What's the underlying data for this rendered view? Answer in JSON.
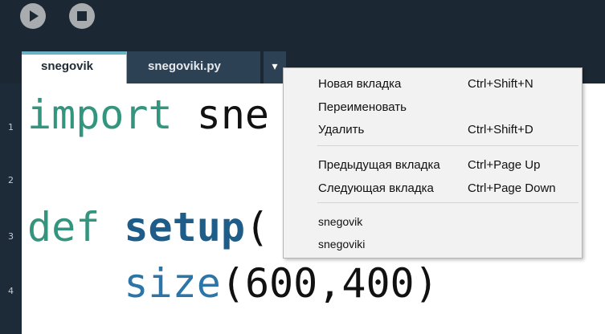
{
  "toolbar": {
    "run_icon": "play-icon",
    "stop_icon": "stop-icon"
  },
  "tabs": [
    {
      "label": "snegovik",
      "active": true
    },
    {
      "label": "snegoviki.py",
      "active": false
    }
  ],
  "tab_menu_arrow": "▾",
  "line_numbers": [
    "1",
    "2",
    "3",
    "4"
  ],
  "code": {
    "line1": {
      "keyword": "import",
      "rest": " sne"
    },
    "line3": {
      "keyword": "def",
      "space": " ",
      "name": "setup",
      "paren": "("
    },
    "line4": {
      "indent": "    ",
      "builtin": "size",
      "args": "(600,400)"
    }
  },
  "context_menu": {
    "items": [
      {
        "label": "Новая вкладка",
        "shortcut": "Ctrl+Shift+N"
      },
      {
        "label": "Переименовать",
        "shortcut": ""
      },
      {
        "label": "Удалить",
        "shortcut": "Ctrl+Shift+D"
      },
      {
        "label": "Предыдущая вкладка",
        "shortcut": "Ctrl+Page Up"
      },
      {
        "label": "Следующая вкладка",
        "shortcut": "Ctrl+Page Down"
      }
    ],
    "tab_list": [
      "snegovik",
      "snegoviki"
    ]
  },
  "colors": {
    "background": "#1c2733",
    "active_tab_accent": "#6ab2c5",
    "tab_divider": "#e3a63a",
    "keyword": "#34957f",
    "function_name": "#1e5d8a"
  }
}
